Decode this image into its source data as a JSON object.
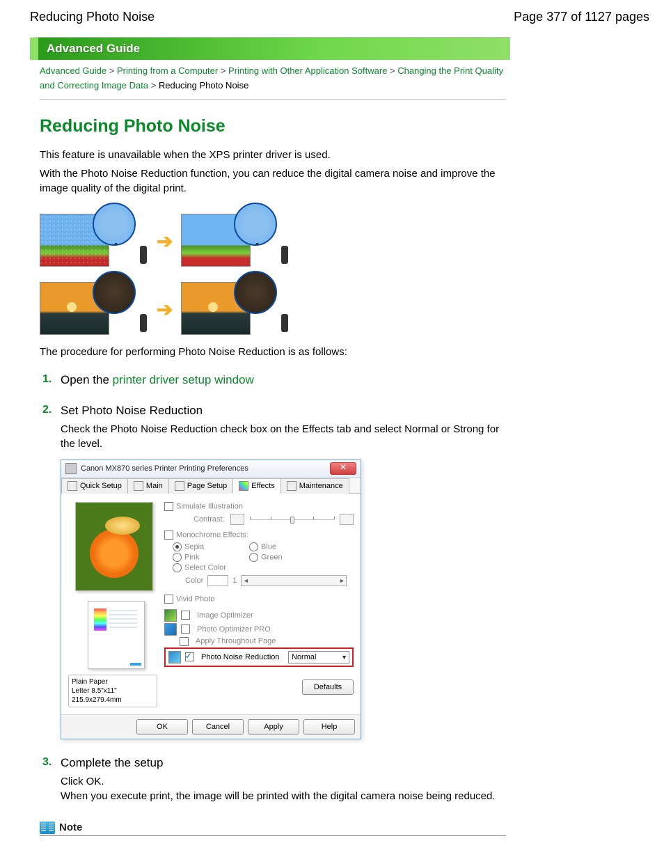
{
  "header": {
    "left_title": "Reducing Photo Noise",
    "page_info": "Page 377 of 1127 pages"
  },
  "banner": "Advanced Guide",
  "breadcrumb": {
    "link1": "Advanced Guide",
    "link2": "Printing from a Computer",
    "link3": "Printing with Other Application Software",
    "link4": "Changing the Print Quality and Correcting Image Data",
    "current": "Reducing Photo Noise",
    "sep": ">"
  },
  "page_title": "Reducing Photo Noise",
  "intro_para1": "This feature is unavailable when the XPS printer driver is used.",
  "intro_para2": "With the Photo Noise Reduction function, you can reduce the digital camera noise and improve the image quality of the digital print.",
  "after_illus": "The procedure for performing Photo Noise Reduction is as follows:",
  "steps": {
    "s1": {
      "num": "1.",
      "prefix": "Open the ",
      "link": "printer driver setup window"
    },
    "s2": {
      "num": "2.",
      "title": "Set Photo Noise Reduction",
      "body": "Check the Photo Noise Reduction check box on the Effects tab and select Normal or Strong for the level."
    },
    "s3": {
      "num": "3.",
      "title": "Complete the setup",
      "body1": "Click OK.",
      "body2": "When you execute print, the image will be printed with the digital camera noise being reduced."
    }
  },
  "dialog": {
    "title": "Canon MX870 series Printer Printing Preferences",
    "tabs": {
      "quick": "Quick Setup",
      "main": "Main",
      "page": "Page Setup",
      "effects": "Effects",
      "maint": "Maintenance"
    },
    "simulate": "Simulate Illustration",
    "contrast": "Contrast:",
    "mono_label": "Monochrome Effects:",
    "mono": {
      "sepia": "Sepia",
      "pink": "Pink",
      "blue": "Blue",
      "green": "Green",
      "select_color": "Select Color",
      "color": "Color"
    },
    "color_value": "1",
    "vivid": "Vivid Photo",
    "image_opt": "Image Optimizer",
    "photo_opt": "Photo Optimizer PRO",
    "apply_page": "Apply Throughout Page",
    "photo_noise": "Photo Noise Reduction",
    "noise_level": "Normal",
    "paper": {
      "line1": "Plain Paper",
      "line2": "Letter 8.5\"x11\" 215.9x279.4mm"
    },
    "buttons": {
      "defaults": "Defaults",
      "ok": "OK",
      "cancel": "Cancel",
      "apply": "Apply",
      "help": "Help"
    }
  },
  "note_label": "Note"
}
